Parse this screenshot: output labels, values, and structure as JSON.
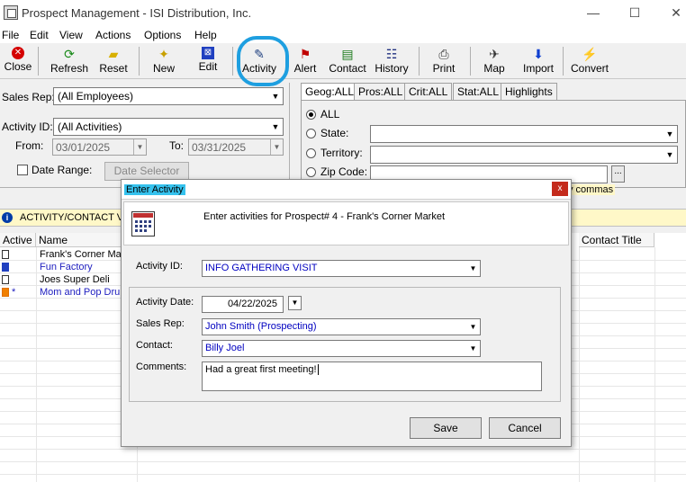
{
  "window": {
    "title": "Prospect Management - ISI Distribution, Inc.",
    "min": "—",
    "max": "☐",
    "close": "✕"
  },
  "menu": [
    "File",
    "Edit",
    "View",
    "Actions",
    "Options",
    "Help"
  ],
  "toolbar": [
    {
      "label": "Close",
      "icon": "close-icon",
      "color": "#d40000",
      "glyph": "✕"
    },
    {
      "label": "Refresh",
      "icon": "refresh-icon",
      "color": "#1a8a1a",
      "glyph": "⟳"
    },
    {
      "label": "Reset",
      "icon": "eraser-icon",
      "color": "#d8b000",
      "glyph": "▰"
    },
    {
      "label": "New",
      "icon": "new-icon",
      "color": "#c8a000",
      "glyph": "✦"
    },
    {
      "label": "Edit",
      "icon": "edit-icon",
      "color": "#2040c0",
      "glyph": "⊠"
    },
    {
      "label": "Activity",
      "icon": "activity-icon",
      "color": "#204080",
      "glyph": "✎"
    },
    {
      "label": "Alert",
      "icon": "flag-icon",
      "color": "#c00000",
      "glyph": "⚑"
    },
    {
      "label": "Contact",
      "icon": "contact-icon",
      "color": "#1a7a1a",
      "glyph": "▤"
    },
    {
      "label": "History",
      "icon": "history-icon",
      "color": "#203080",
      "glyph": "☷"
    },
    {
      "label": "Print",
      "icon": "print-icon",
      "color": "#333333",
      "glyph": "⎙"
    },
    {
      "label": "Map",
      "icon": "map-icon",
      "color": "#333333",
      "glyph": "✈"
    },
    {
      "label": "Import",
      "icon": "import-icon",
      "color": "#1040d0",
      "glyph": "⬇"
    },
    {
      "label": "Convert",
      "icon": "convert-icon",
      "color": "#d0a000",
      "glyph": "⚡"
    }
  ],
  "filters": {
    "sales_rep_label": "Sales Rep:",
    "sales_rep_value": "(All Employees)",
    "activity_id_label": "Activity ID:",
    "activity_id_value": "(All Activities)",
    "from_label": "From:",
    "from_value": "03/01/2025",
    "to_label": "To:",
    "to_value": "03/31/2025",
    "date_range_label": "Date Range:",
    "date_selector_label": "Date Selector"
  },
  "tabs": [
    "Geog:ALL",
    "Pros:ALL",
    "Crit:ALL",
    "Stat:ALL",
    "Highlights"
  ],
  "geo": {
    "all_label": "ALL",
    "state_label": "State:",
    "territory_label": "Territory:",
    "zip_label": "Zip Code:",
    "zip_browse": "...",
    "hint_fragment": "y commas"
  },
  "infobar": {
    "text": "ACTIVITY/CONTACT VI"
  },
  "grid": {
    "columns": [
      "Active",
      "Name",
      "Contact Title"
    ],
    "rows": [
      {
        "name": "Frank's Corner Ma...",
        "color": "#000000",
        "marker": ""
      },
      {
        "name": "Fun Factory",
        "color": "#2020c0",
        "marker": ""
      },
      {
        "name": "Joes Super Deli",
        "color": "#000000",
        "marker": ""
      },
      {
        "name": "Mom and Pop Dru...",
        "color": "#2020c0",
        "marker": "*"
      }
    ]
  },
  "dialog": {
    "title": "Enter Activity",
    "close": "x",
    "header_text": "Enter activities for Prospect# 4 - Frank's Corner Market",
    "activity_id_label": "Activity ID:",
    "activity_id_value": "INFO GATHERING VISIT",
    "activity_date_label": "Activity Date:",
    "activity_date_value": "04/22/2025",
    "sales_rep_label": "Sales Rep:",
    "sales_rep_value": "John Smith (Prospecting)",
    "contact_label": "Contact:",
    "contact_value": "Billy Joel",
    "comments_label": "Comments:",
    "comments_value": "Had a great first meeting!",
    "save_label": "Save",
    "cancel_label": "Cancel"
  }
}
